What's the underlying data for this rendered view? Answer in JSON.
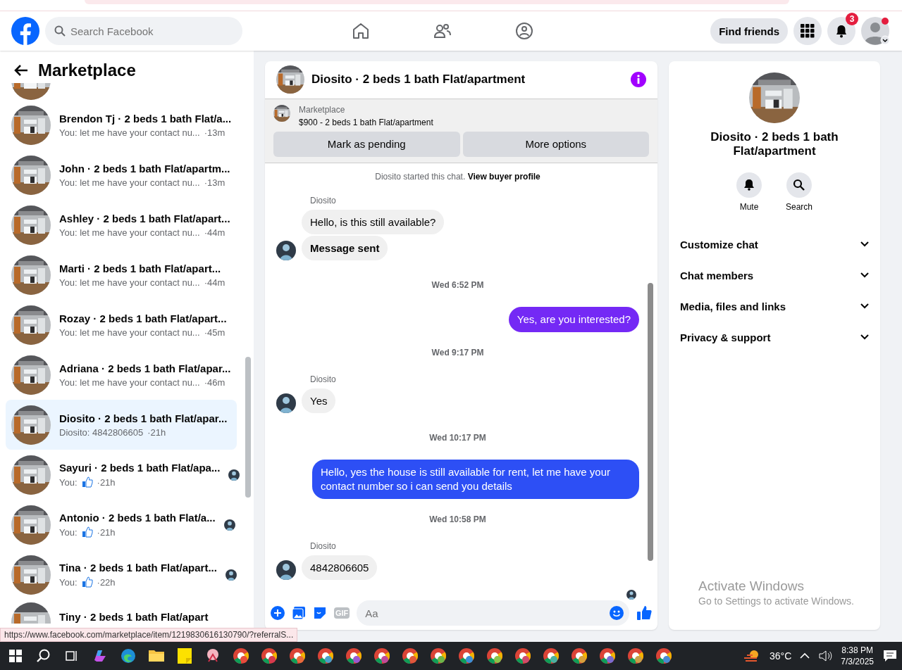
{
  "top_bar": {
    "search": {
      "placeholder": "Search Facebook"
    },
    "find_friends": "Find friends",
    "notification_count": "3"
  },
  "sidebar": {
    "title": "Marketplace",
    "conversations": [
      {
        "name": "Brendon Tj · 2 beds 1 bath Flat/a...",
        "kind": "text",
        "preview": "You: let me have your contact nu...",
        "time": "·13m",
        "selected": false,
        "seen_avatar": false
      },
      {
        "name": "John · 2 beds 1 bath Flat/apartm...",
        "kind": "text",
        "preview": "You: let me have your contact nu...",
        "time": "·13m",
        "selected": false,
        "seen_avatar": false
      },
      {
        "name": "Ashley · 2 beds 1 bath Flat/apart...",
        "kind": "text",
        "preview": "You: let me have your contact nu...",
        "time": "·44m",
        "selected": false,
        "seen_avatar": false
      },
      {
        "name": "Marti · 2 beds 1 bath Flat/apart...",
        "kind": "text",
        "preview": "You: let me have your contact nu...",
        "time": "·44m",
        "selected": false,
        "seen_avatar": false
      },
      {
        "name": "Rozay · 2 beds 1 bath Flat/apart...",
        "kind": "text",
        "preview": "You: let me have your contact nu...",
        "time": "·45m",
        "selected": false,
        "seen_avatar": false
      },
      {
        "name": "Adriana · 2 beds 1 bath Flat/apar...",
        "kind": "text",
        "preview": "You: let me have your contact nu...",
        "time": "·46m",
        "selected": false,
        "seen_avatar": false
      },
      {
        "name": "Diosito · 2 beds 1 bath Flat/apar...",
        "kind": "text",
        "preview": "Diosito: 4842806605",
        "time": "·21h",
        "selected": true,
        "seen_avatar": false
      },
      {
        "name": "Sayuri · 2 beds 1 bath Flat/apa...",
        "kind": "like",
        "preview": "You:",
        "time": "·21h",
        "selected": false,
        "seen_avatar": true
      },
      {
        "name": "Antonio · 2 beds 1 bath Flat/a...",
        "kind": "like",
        "preview": "You:",
        "time": "·21h",
        "selected": false,
        "seen_avatar": true
      },
      {
        "name": "Tina · 2 beds 1 bath Flat/apart...",
        "kind": "like",
        "preview": "You:",
        "time": "·22h",
        "selected": false,
        "seen_avatar": true
      },
      {
        "name": "Tiny · 2 beds 1 bath Flat/apart",
        "kind": "partial"
      }
    ]
  },
  "chat": {
    "title": "Diosito · 2 beds 1 bath Flat/apartment",
    "listing": {
      "label": "Marketplace",
      "title": "$900 - 2 beds 1 bath Flat/apartment"
    },
    "buttons": [
      "Mark as pending",
      "More options"
    ],
    "started": {
      "text": "Diosito started this chat.",
      "link": "View buyer profile"
    },
    "messages": [
      {
        "kind": "incoming",
        "sender": "Diosito",
        "bubbles": [
          {
            "text": "Hello, is this still available?",
            "bold": false
          },
          {
            "text": "Message sent",
            "bold": true
          }
        ]
      },
      {
        "kind": "timestamp",
        "text": "Wed 6:52 PM"
      },
      {
        "kind": "outgoing",
        "text": "Yes, are you interested?",
        "color": "#7429f5"
      },
      {
        "kind": "timestamp",
        "text": "Wed 9:17 PM"
      },
      {
        "kind": "incoming",
        "sender": "Diosito",
        "bubbles": [
          {
            "text": "Yes",
            "bold": false
          }
        ]
      },
      {
        "kind": "timestamp",
        "text": "Wed 10:17 PM"
      },
      {
        "kind": "outgoing",
        "text": "Hello, yes the house is still available for rent, let me have your contact number so i can send you details",
        "color": "#2d4ff5"
      },
      {
        "kind": "timestamp",
        "text": "Wed 10:58 PM"
      },
      {
        "kind": "incoming",
        "sender": "Diosito",
        "bubbles": [
          {
            "text": "4842806605",
            "bold": false
          }
        ]
      }
    ],
    "seen": true,
    "composer": {
      "placeholder": "Aa",
      "gif": "GIF"
    }
  },
  "details": {
    "title": "Diosito · 2 beds 1 bath Flat/apartment",
    "actions": [
      {
        "kind": "mute",
        "label": "Mute"
      },
      {
        "kind": "search",
        "label": "Search"
      }
    ],
    "sections": [
      "Customize chat",
      "Chat members",
      "Media, files and links",
      "Privacy & support"
    ]
  },
  "activation": {
    "title": "Activate Windows",
    "subtitle": "Go to Settings to activate Windows."
  },
  "status_url": "https://www.facebook.com/marketplace/item/1219830616130790/?referralS...",
  "taskbar": {
    "weather": "36°C",
    "time": "8:38 PM",
    "date": "7/3/2025"
  }
}
